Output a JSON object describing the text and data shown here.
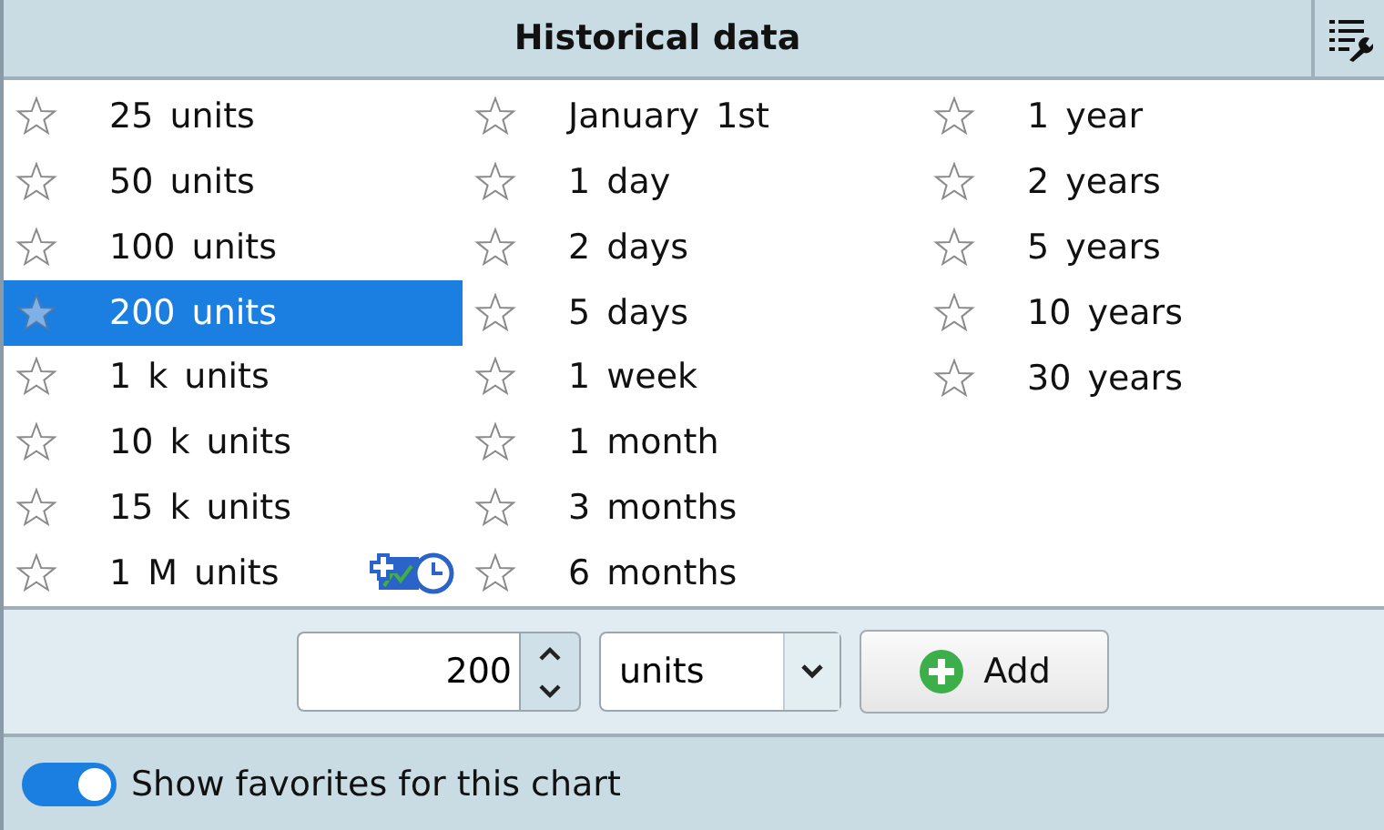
{
  "header": {
    "title": "Historical data"
  },
  "columns": [
    [
      {
        "label": "25 units",
        "selected": false,
        "favorite": false,
        "kind": "plain"
      },
      {
        "label": "50 units",
        "selected": false,
        "favorite": false,
        "kind": "plain"
      },
      {
        "label": "100 units",
        "selected": false,
        "favorite": false,
        "kind": "plain"
      },
      {
        "label": "200 units",
        "selected": true,
        "favorite": true,
        "kind": "plain"
      },
      {
        "label": "1 k units",
        "selected": false,
        "favorite": false,
        "kind": "plain"
      },
      {
        "label": "10 k units",
        "selected": false,
        "favorite": false,
        "kind": "plain"
      },
      {
        "label": "15 k units",
        "selected": false,
        "favorite": false,
        "kind": "plain"
      },
      {
        "label": "1 M units",
        "selected": false,
        "favorite": false,
        "kind": "chart-icon"
      }
    ],
    [
      {
        "label": "January 1st",
        "selected": false,
        "favorite": false,
        "kind": "plain"
      },
      {
        "label": "1 day",
        "selected": false,
        "favorite": false,
        "kind": "plain"
      },
      {
        "label": "2 days",
        "selected": false,
        "favorite": false,
        "kind": "plain"
      },
      {
        "label": "5 days",
        "selected": false,
        "favorite": false,
        "kind": "plain"
      },
      {
        "label": "1 week",
        "selected": false,
        "favorite": false,
        "kind": "plain"
      },
      {
        "label": "1 month",
        "selected": false,
        "favorite": false,
        "kind": "plain"
      },
      {
        "label": "3 months",
        "selected": false,
        "favorite": false,
        "kind": "plain"
      },
      {
        "label": "6 months",
        "selected": false,
        "favorite": false,
        "kind": "plain"
      }
    ],
    [
      {
        "label": "1 year",
        "selected": false,
        "favorite": false,
        "kind": "plain"
      },
      {
        "label": "2 years",
        "selected": false,
        "favorite": false,
        "kind": "plain"
      },
      {
        "label": "5 years",
        "selected": false,
        "favorite": false,
        "kind": "plain"
      },
      {
        "label": "10 years",
        "selected": false,
        "favorite": false,
        "kind": "plain"
      },
      {
        "label": "30 years",
        "selected": false,
        "favorite": false,
        "kind": "plain"
      }
    ]
  ],
  "controls": {
    "amount": "200",
    "unit": "units",
    "add_button": "Add"
  },
  "footer": {
    "toggle_on": true,
    "label": "Show favorites for this chart"
  }
}
